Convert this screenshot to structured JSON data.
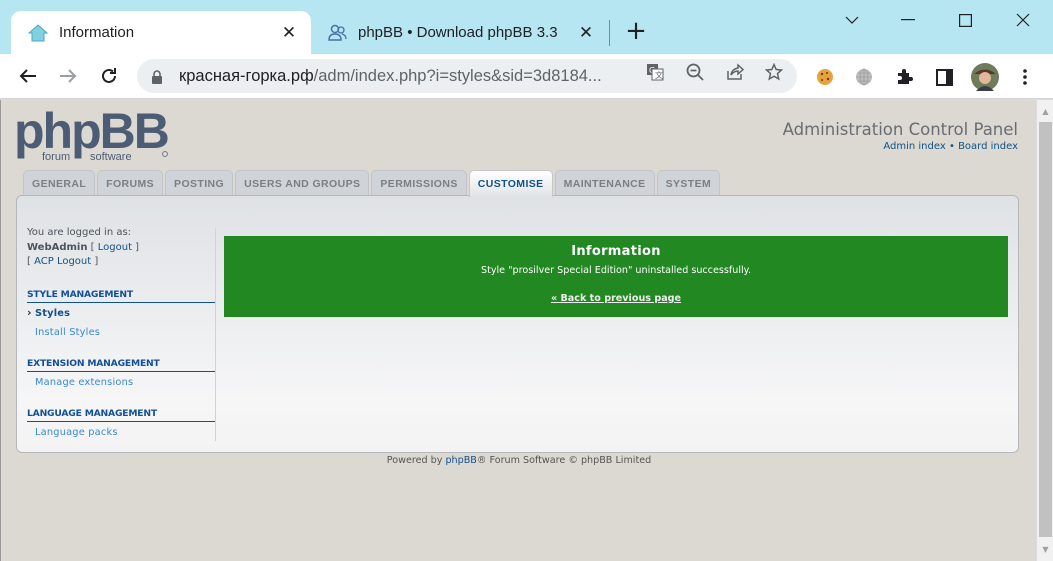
{
  "browser": {
    "tabs": [
      {
        "title": "Information",
        "icon": "phpbb-house-favicon",
        "active": true
      },
      {
        "title": "phpBB • Download phpBB 3.3",
        "icon": "users-favicon",
        "active": false
      }
    ],
    "new_tab_label": "+",
    "url_host": "красная-горка.рф",
    "url_path": "/adm/index.php?i=styles&sid=3d8184...",
    "nav": {
      "back": "←",
      "forward": "→",
      "reload": "↻"
    },
    "window_controls": {
      "tab_search": "⌄",
      "minimize": "—",
      "maximize": "☐",
      "close": "✕"
    },
    "omnibox_icons": [
      "translate-icon",
      "zoom-out-icon",
      "share-icon",
      "bookmark-star-icon"
    ],
    "extensions": [
      "cookie-icon",
      "globe-icon",
      "puzzle-icon",
      "sidepanel-icon",
      "profile-avatar",
      "menu-icon"
    ]
  },
  "header": {
    "logo_main": "phpBB",
    "logo_sub_left": "forum",
    "logo_sub_right": "software",
    "title": "Administration Control Panel",
    "links": {
      "admin_index": "Admin index",
      "separator": "•",
      "board_index": "Board index"
    }
  },
  "tabs": [
    {
      "label": "GENERAL",
      "active": false
    },
    {
      "label": "FORUMS",
      "active": false
    },
    {
      "label": "POSTING",
      "active": false
    },
    {
      "label": "USERS AND GROUPS",
      "active": false
    },
    {
      "label": "PERMISSIONS",
      "active": false
    },
    {
      "label": "CUSTOMISE",
      "active": true
    },
    {
      "label": "MAINTENANCE",
      "active": false
    },
    {
      "label": "SYSTEM",
      "active": false
    }
  ],
  "sidebar": {
    "logged_in_label": "You are logged in as:",
    "username": "WebAdmin",
    "logout": "Logout",
    "acp_logout": "ACP Logout",
    "sections": [
      {
        "heading": "STYLE MANAGEMENT",
        "items": [
          {
            "label": "Styles",
            "active": true
          },
          {
            "label": "Install Styles",
            "active": false
          }
        ]
      },
      {
        "heading": "EXTENSION MANAGEMENT",
        "items": [
          {
            "label": "Manage extensions",
            "active": false
          }
        ]
      },
      {
        "heading": "LANGUAGE MANAGEMENT",
        "items": [
          {
            "label": "Language packs",
            "active": false
          }
        ]
      }
    ]
  },
  "message": {
    "title": "Information",
    "text": "Style \"prosilver Special Edition\" uninstalled successfully.",
    "back_link": "« Back to previous page",
    "color": "#228822"
  },
  "footer": {
    "prefix": "Powered by ",
    "phpbb_link": "phpBB",
    "suffix": "® Forum Software © phpBB Limited"
  }
}
